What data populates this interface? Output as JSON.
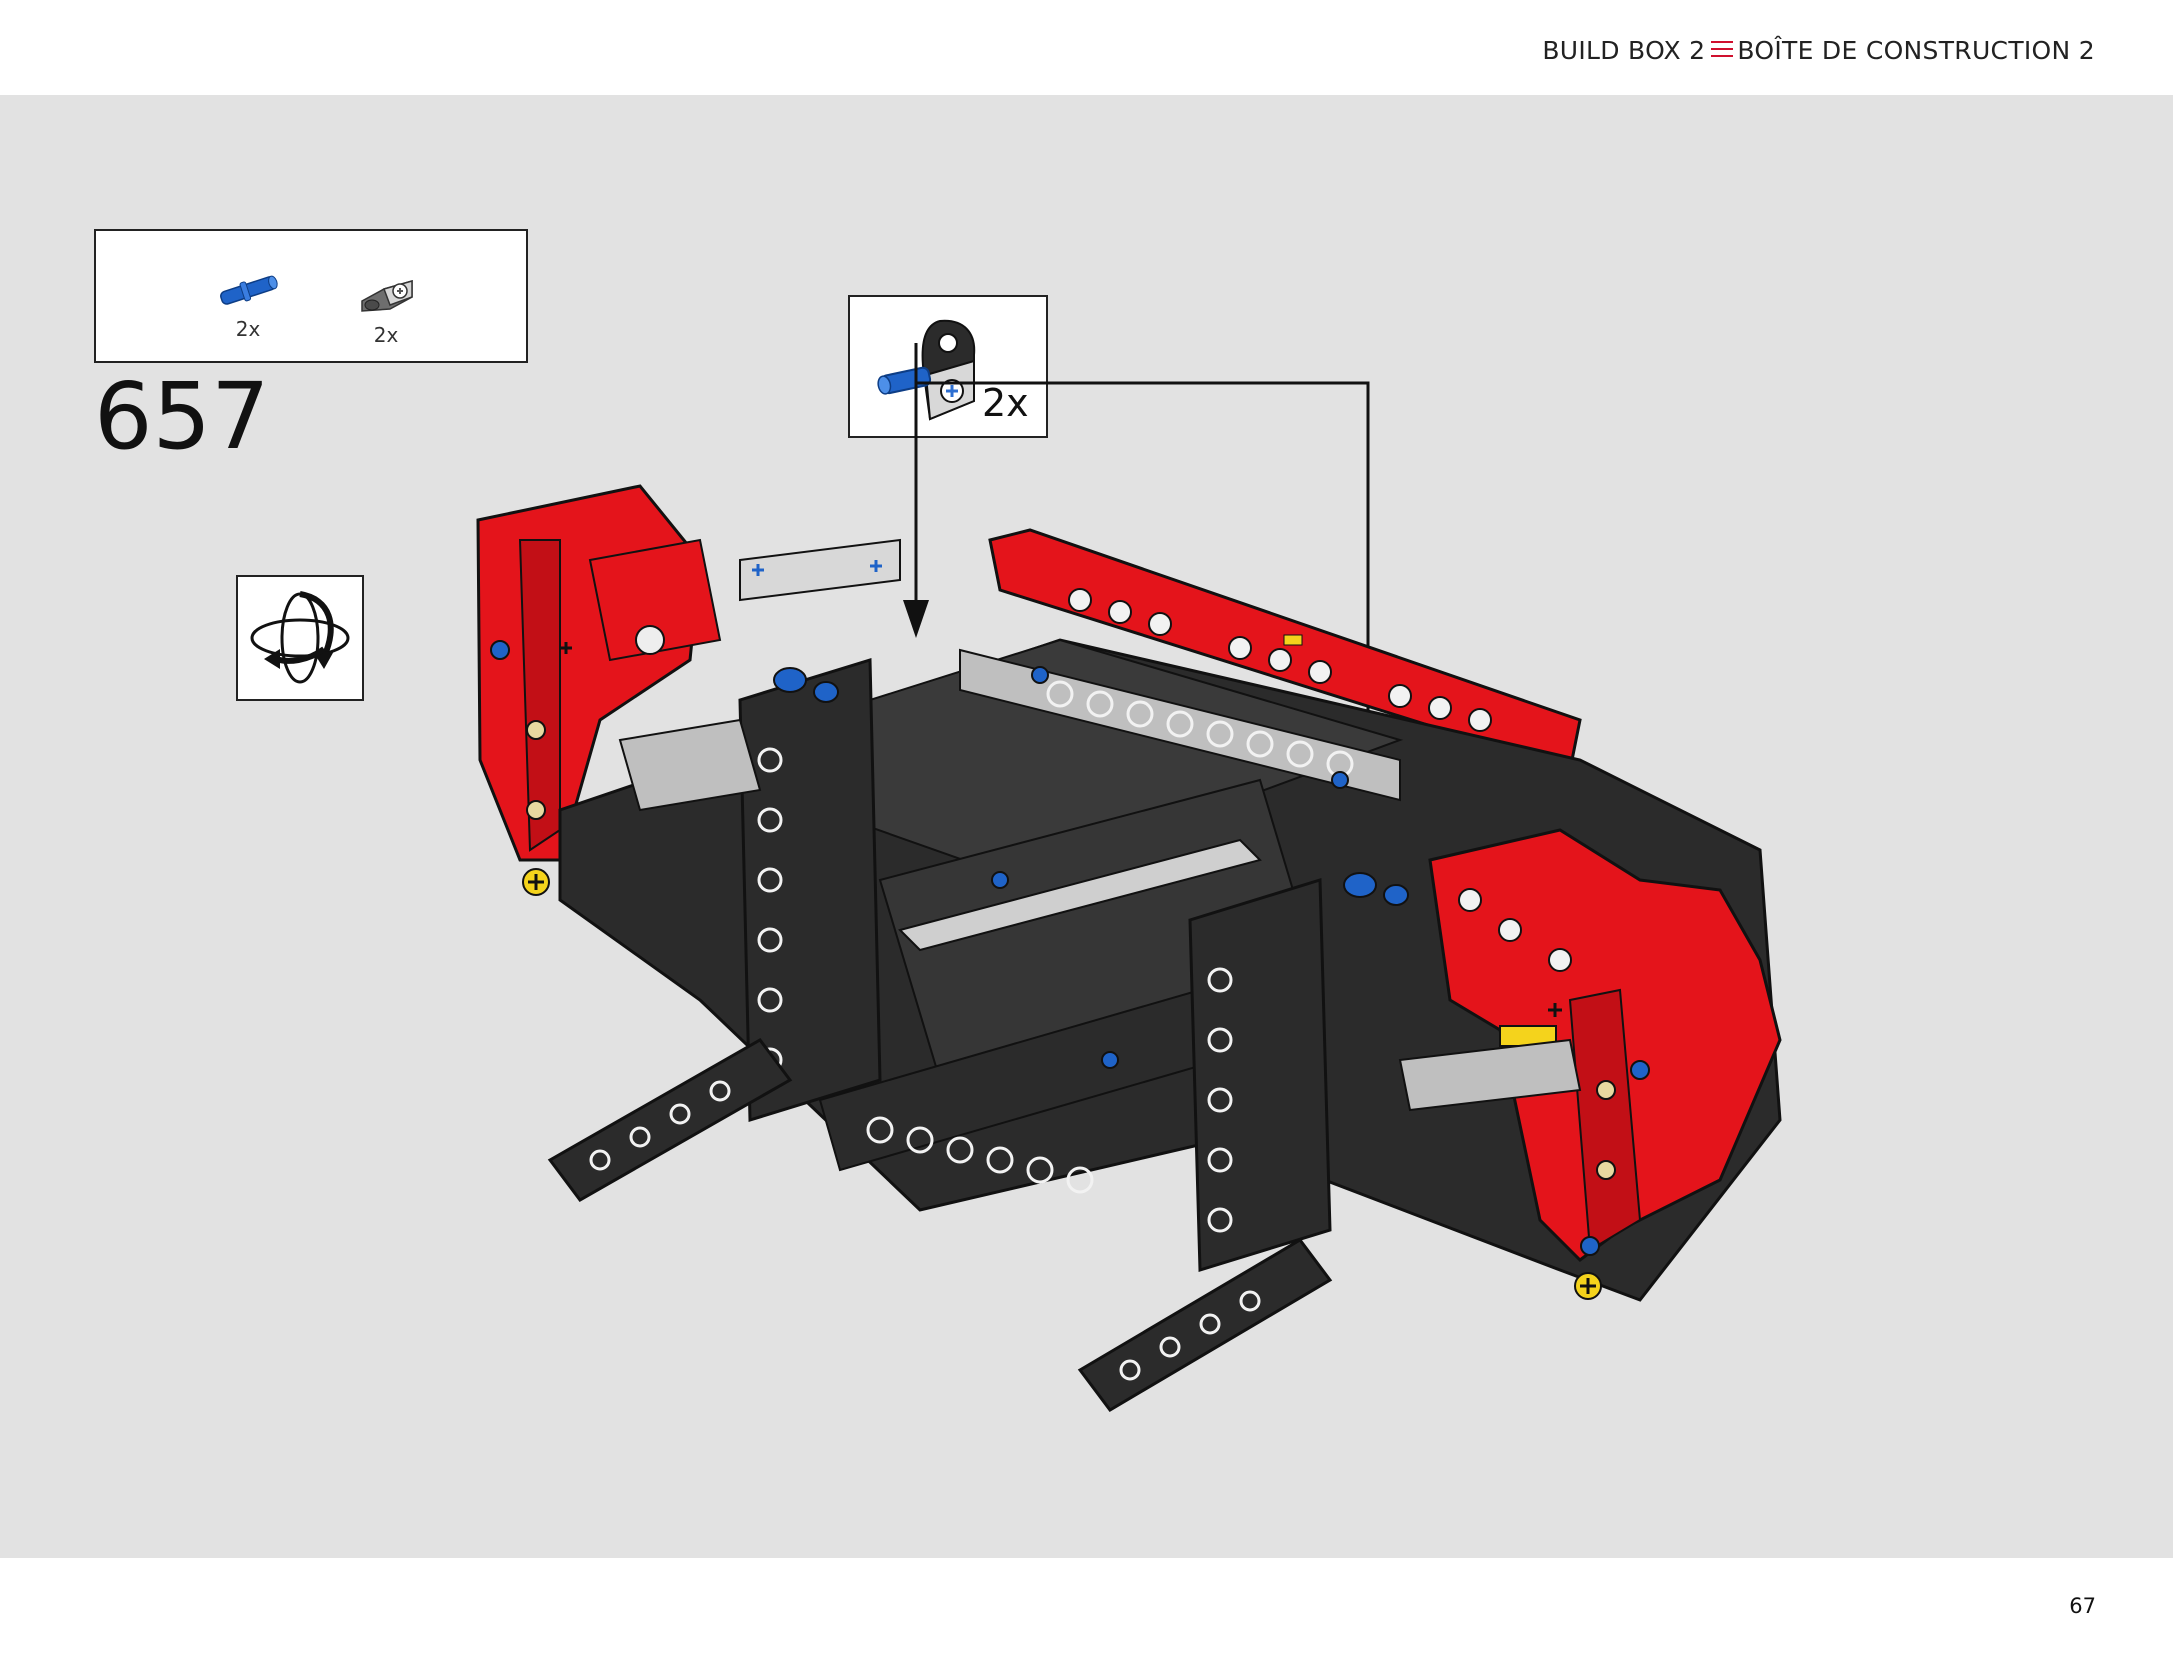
{
  "header": {
    "label_en": "BUILD BOX 2",
    "label_fr": "BOÎTE DE CONSTRUCTION 2"
  },
  "parts_list": [
    {
      "icon": "blue-axle-pin-icon",
      "qty": "2x"
    },
    {
      "icon": "grey-pin-connector-icon",
      "qty": "2x"
    }
  ],
  "step": {
    "number": "657"
  },
  "callout": {
    "qty": "2x",
    "icon": "pin-with-connector-subassembly-icon"
  },
  "rotate_icon": "rotate-model-icon",
  "footer": {
    "page_number": "67"
  },
  "colors": {
    "background": "#e2e2e2",
    "accent_red": "#d0102e",
    "part_red": "#e4141b",
    "part_dark": "#2b2b2b",
    "part_blue": "#1f63c8",
    "part_grey": "#bfbfbf"
  }
}
